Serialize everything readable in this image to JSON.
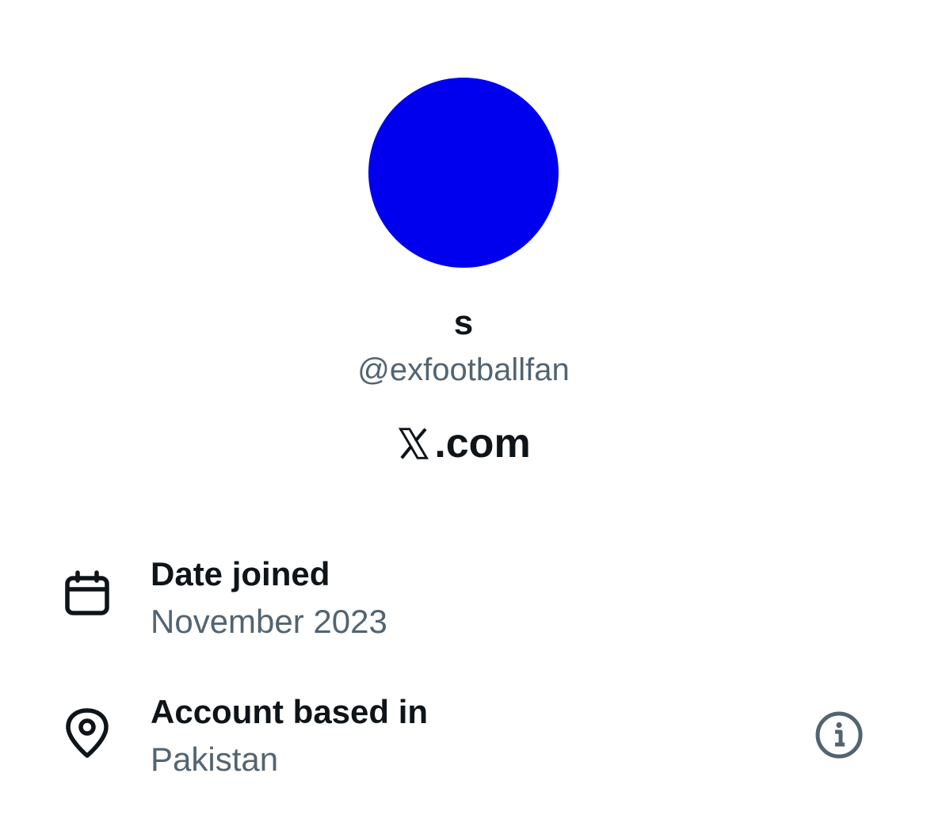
{
  "profile": {
    "avatar_color": "#0000ee",
    "display_name": "s",
    "handle": "@exfootballfan",
    "brand_suffix": ".com"
  },
  "details": {
    "date_joined": {
      "label": "Date joined",
      "value": "November 2023",
      "icon": "calendar-icon"
    },
    "location": {
      "label": "Account based in",
      "value": "Pakistan",
      "icon": "location-pin-icon",
      "info_icon": "info-icon"
    }
  },
  "colors": {
    "text_primary": "#0f1419",
    "text_secondary": "#536471"
  }
}
